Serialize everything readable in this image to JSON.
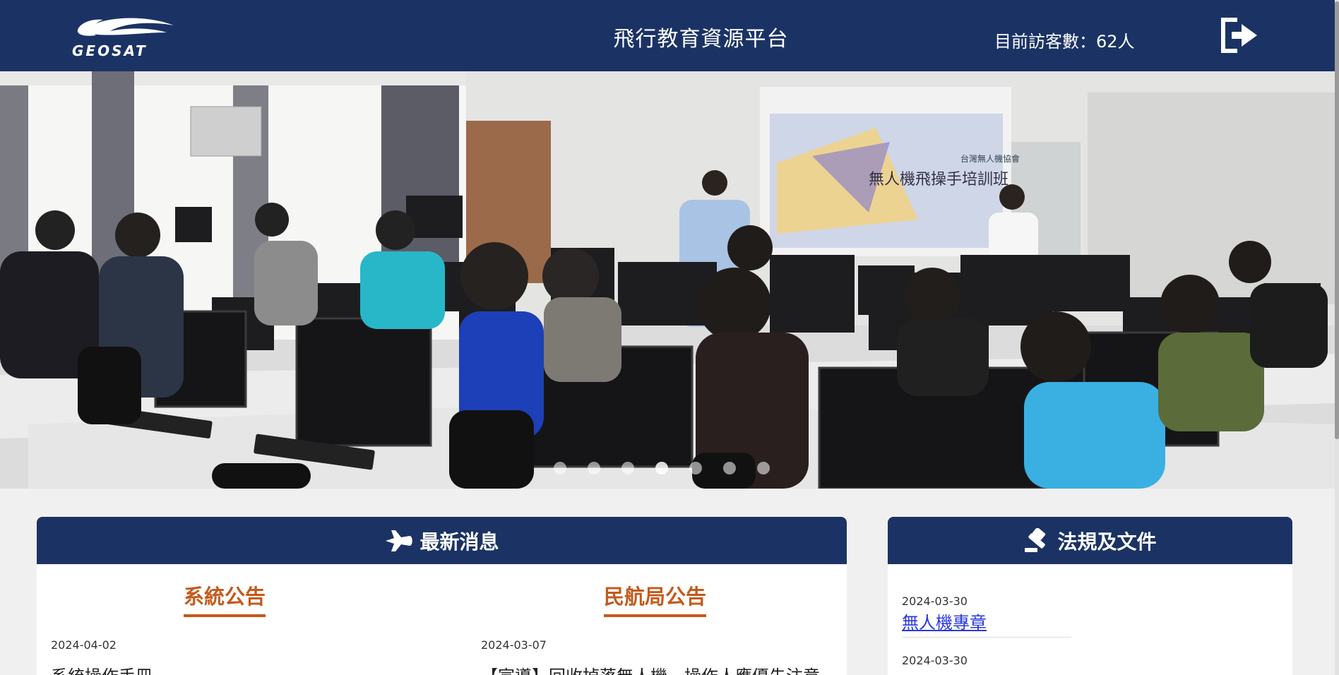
{
  "header": {
    "logo_text": "GEOSAT",
    "site_title": "飛行教育資源平台",
    "visitor_label": "目前訪客數：62人"
  },
  "carousel": {
    "slide_count": 7,
    "active_index": 3,
    "slide_text": {
      "screen_title": "無人機飛操手培訓班",
      "screen_org": "台灣無人機協會"
    }
  },
  "news": {
    "heading": "最新消息",
    "system": {
      "title": "系統公告",
      "items": [
        {
          "date": "2024-04-02",
          "text": "系統操作手冊"
        }
      ]
    },
    "caa": {
      "title": "民航局公告",
      "items": [
        {
          "date": "2024-03-07",
          "text": "【宣導】回收掉落無人機，操作人應優先注意"
        }
      ]
    }
  },
  "laws": {
    "heading": "法規及文件",
    "items": [
      {
        "date": "2024-03-30",
        "title": "無人機專章"
      },
      {
        "date": "2024-03-30",
        "title": ""
      }
    ]
  },
  "colors": {
    "navy": "#1b3364",
    "accent": "#c45a1c",
    "link": "#2a3adb"
  }
}
